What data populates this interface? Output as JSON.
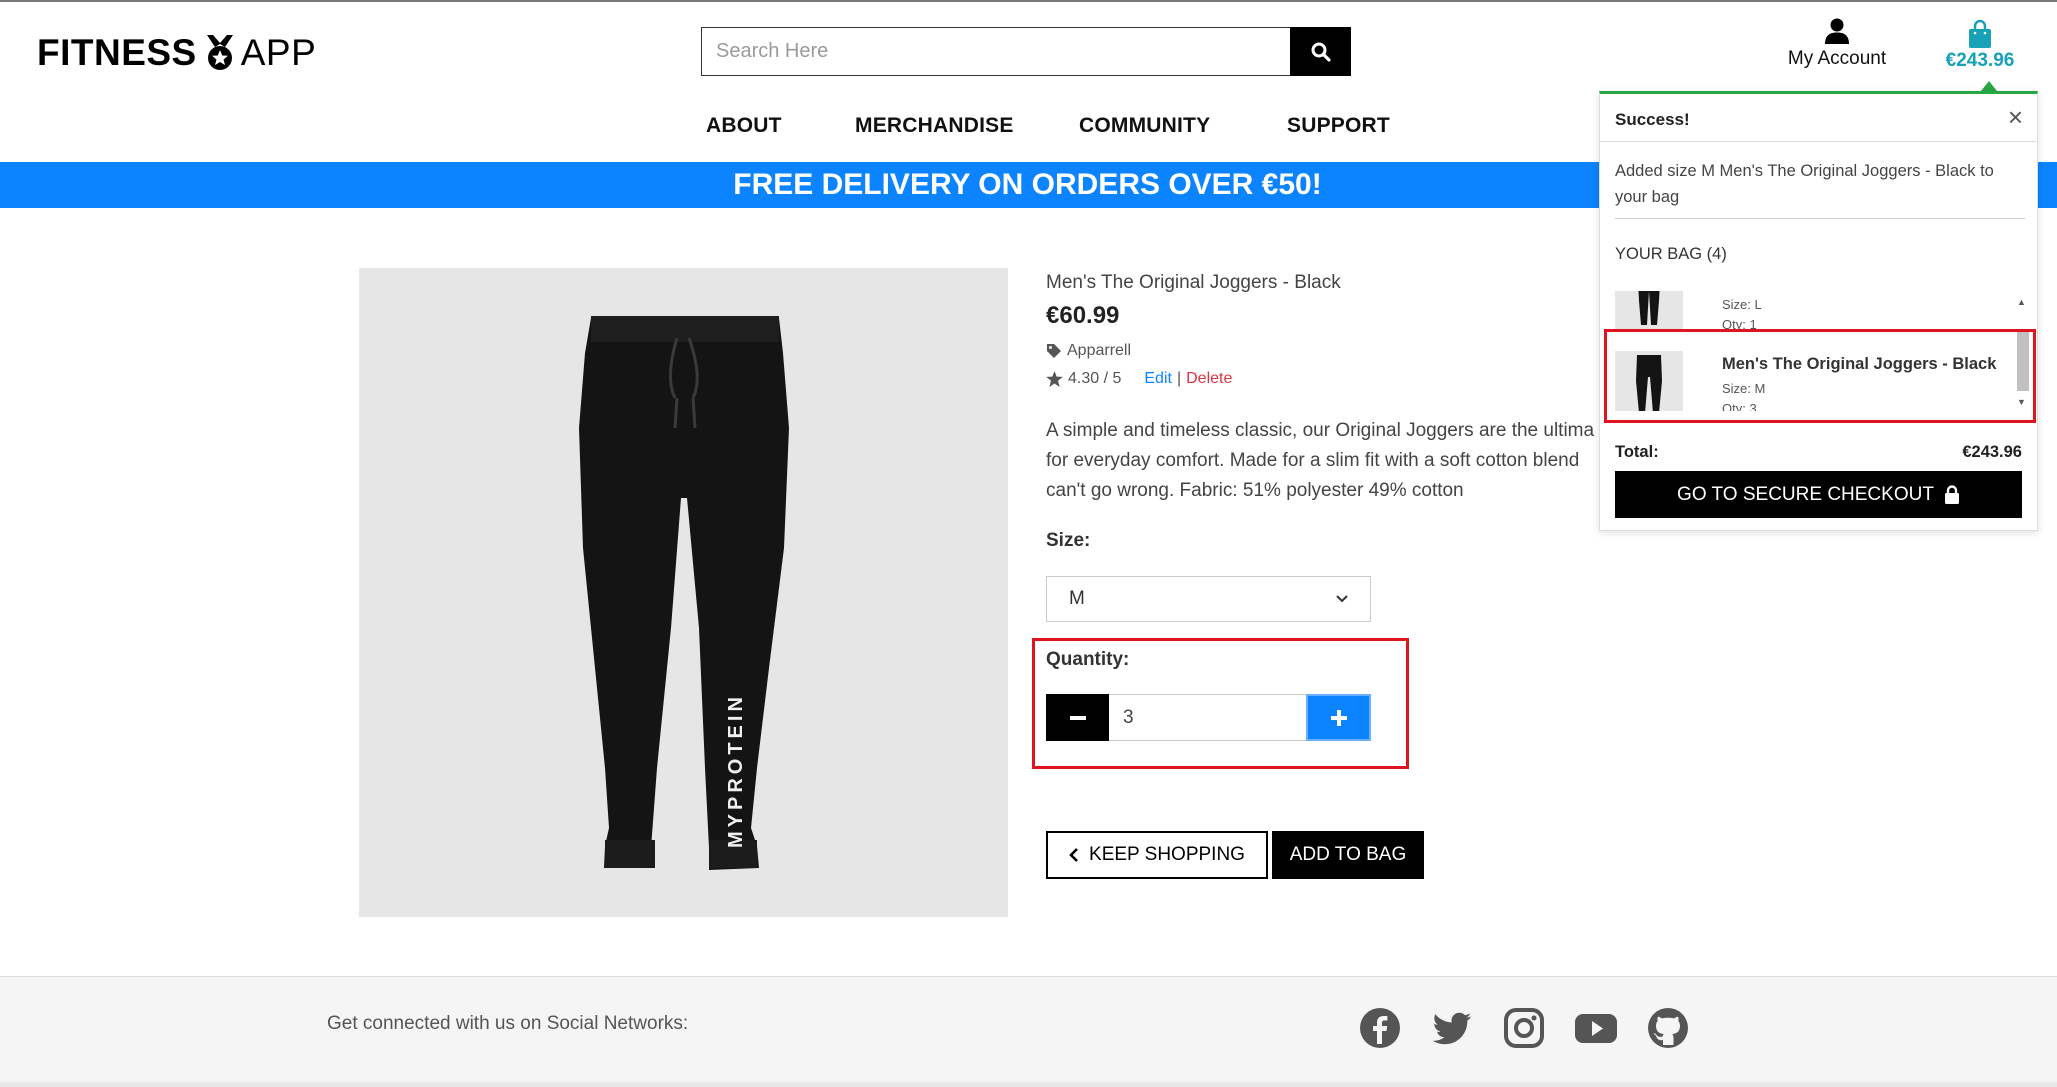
{
  "header": {
    "logo_left": "FITNESS",
    "logo_right": "APP",
    "search_placeholder": "Search Here",
    "account_label": "My Account",
    "bag_total": "€243.96"
  },
  "nav": {
    "items": [
      "ABOUT",
      "MERCHANDISE",
      "COMMUNITY",
      "SUPPORT"
    ]
  },
  "banner": {
    "text": "FREE DELIVERY ON ORDERS OVER €50!"
  },
  "product": {
    "name": "Men's The Original Joggers - Black",
    "price": "€60.99",
    "category": "Apparrell",
    "rating": "4.30 / 5",
    "edit_label": "Edit",
    "separator": "|",
    "delete_label": "Delete",
    "description_lines": [
      "A simple and timeless classic, our Original Joggers are the ultima",
      "for everyday comfort. Made for a slim fit with a soft cotton blend",
      "can't go wrong. Fabric: 51% polyester 49% cotton"
    ],
    "image_text": "MYPROTEIN",
    "size_label": "Size:",
    "size_value": "M",
    "quantity_label": "Quantity:",
    "quantity_value": "3",
    "keep_shopping_label": "KEEP SHOPPING",
    "add_to_bag_label": "ADD TO BAG"
  },
  "popup": {
    "title": "Success!",
    "close": "×",
    "message": "Added size M Men's The Original Joggers - Black to your bag",
    "bag_title": "YOUR BAG (4)",
    "items": [
      {
        "name": "",
        "size": "Size: L",
        "qty": "Qty: 1"
      },
      {
        "name": "Men's The Original Joggers - Black",
        "size": "Size: M",
        "qty": "Qty: 3"
      }
    ],
    "total_label": "Total:",
    "total_value": "€243.96",
    "checkout_label": "GO TO SECURE CHECKOUT"
  },
  "footer": {
    "text": "Get connected with us on Social Networks:",
    "socials": [
      "facebook-icon",
      "twitter-icon",
      "instagram-icon",
      "youtube-icon",
      "github-icon"
    ]
  },
  "colors": {
    "accent_blue": "#0d84ff",
    "teal": "#17a2b8",
    "success_green": "#28a745",
    "delete_red": "#dc3545",
    "highlight_red": "#e0141e"
  }
}
